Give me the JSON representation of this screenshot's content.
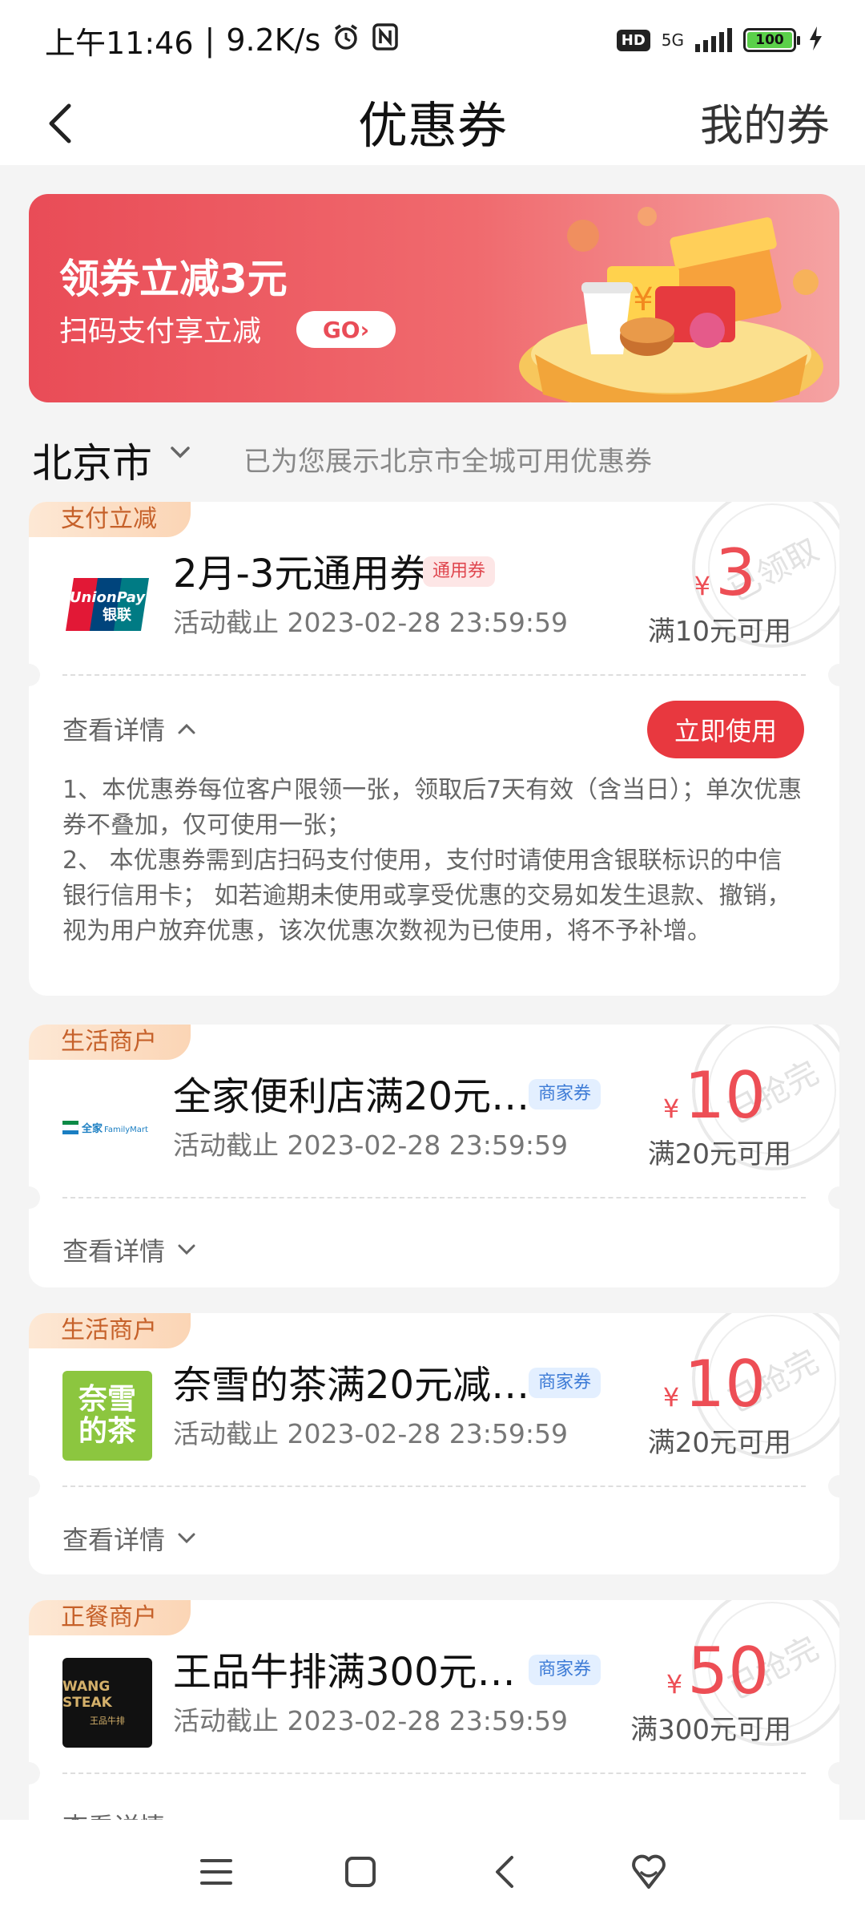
{
  "status_bar": {
    "time": "上午11:46",
    "speed": "9.2K/s",
    "hd": "HD",
    "network": "5G",
    "battery": "100"
  },
  "header": {
    "title": "优惠券",
    "right_link": "我的券"
  },
  "banner": {
    "title": "领券立减3元",
    "subtitle": "扫码支付享立减",
    "go": "GO›"
  },
  "city": {
    "name": "北京市",
    "hint": "已为您展示北京市全城可用优惠券"
  },
  "coupons": [
    {
      "tag": "支付立减",
      "title": "2月-3元通用券",
      "badge": "通用券",
      "deadline": "活动截止 2023-02-28 23:59:59",
      "currency": "¥",
      "amount": "3",
      "condition": "满10元可用",
      "stamp": "已领取",
      "details": "查看详情",
      "use_button": "立即使用",
      "rules": [
        "1、本优惠券每位客户限领一张，领取后7天有效（含当日）；单次优惠券不叠加，仅可使用一张；",
        "2、 本优惠券需到店扫码支付使用，支付时请使用含银联标识的中信银行信用卡； 如若逾期未使用或享受优惠的交易如发生退款、撤销，视为用户放弃优惠，该次优惠次数视为已使用，将不予补增。"
      ],
      "logo_text": [
        "UnionPay",
        "银联"
      ]
    },
    {
      "tag": "生活商户",
      "title": "全家便利店满20元…",
      "badge": "商家券",
      "deadline": "活动截止 2023-02-28 23:59:59",
      "currency": "¥",
      "amount": "10",
      "condition": "满20元可用",
      "stamp": "已抢完",
      "details": "查看详情",
      "logo_text": [
        "全家",
        "FamilyMart"
      ]
    },
    {
      "tag": "生活商户",
      "title": "奈雪的茶满20元减…",
      "badge": "商家券",
      "deadline": "活动截止 2023-02-28 23:59:59",
      "currency": "¥",
      "amount": "10",
      "condition": "满20元可用",
      "stamp": "已抢完",
      "details": "查看详情",
      "logo_text": [
        "奈雪",
        "的茶"
      ]
    },
    {
      "tag": "正餐商户",
      "title": "王品牛排满300元…",
      "badge": "商家券",
      "deadline": "活动截止 2023-02-28 23:59:59",
      "currency": "¥",
      "amount": "50",
      "condition": "满300元可用",
      "stamp": "已抢完",
      "details": "查看详情",
      "logo_text": [
        "WANG STEAK",
        "王品牛排"
      ]
    }
  ],
  "colors": {
    "accent_red": "#e8383f",
    "amount_red": "#ed4e55",
    "tag_orange": "#c6612a"
  }
}
